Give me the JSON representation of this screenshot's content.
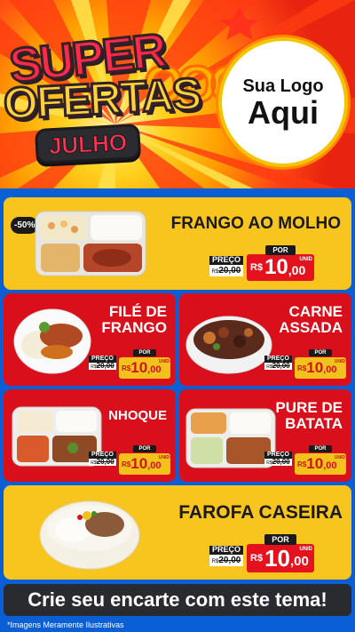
{
  "hero": {
    "title_line1": "SUPER",
    "title_line2": "OFERTAS",
    "month": "JULHO",
    "logo_line1": "Sua Logo",
    "logo_line2": "Aqui"
  },
  "badge": "-50%",
  "price_labels": {
    "preco": "PREÇO",
    "por": "POR",
    "unid": "UNID",
    "currency": "R$"
  },
  "products": [
    {
      "name": "FRANGO AO MOLHO",
      "old_price": "20,00",
      "new_int": "10",
      "new_dec": ",00"
    },
    {
      "name": "FILÉ DE FRANGO",
      "old_price": "20,00",
      "new_int": "10",
      "new_dec": ",00"
    },
    {
      "name": "CARNE ASSADA",
      "old_price": "20,00",
      "new_int": "10",
      "new_dec": ",00"
    },
    {
      "name": "NHOQUE",
      "old_price": "20,00",
      "new_int": "10",
      "new_dec": ",00"
    },
    {
      "name": "PURE DE BATATA",
      "old_price": "20,00",
      "new_int": "10",
      "new_dec": ",00"
    },
    {
      "name": "FAROFA CASEIRA",
      "old_price": "20,00",
      "new_int": "10",
      "new_dec": ",00"
    }
  ],
  "cta": "Crie seu encarte com este tema!",
  "disclaimer": "*Imagens Meramente Ilustrativas",
  "colors": {
    "yellow": "#f7c51e",
    "red": "#d9101c",
    "blue": "#0b5fd6",
    "dark": "#2a2b30"
  }
}
